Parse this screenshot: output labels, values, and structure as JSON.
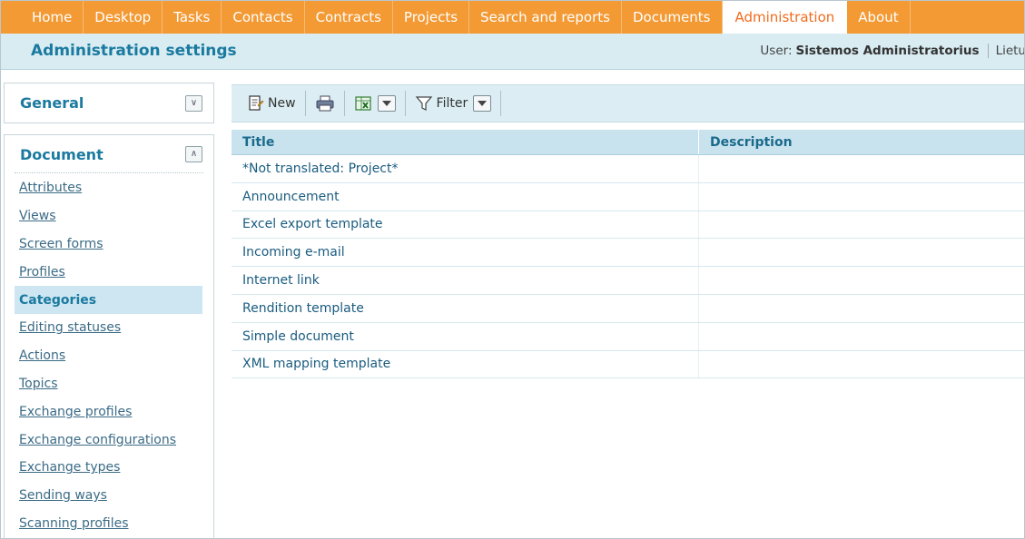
{
  "nav": {
    "tabs": [
      {
        "label": "Home"
      },
      {
        "label": "Desktop"
      },
      {
        "label": "Tasks"
      },
      {
        "label": "Contacts"
      },
      {
        "label": "Contracts"
      },
      {
        "label": "Projects"
      },
      {
        "label": "Search and reports"
      },
      {
        "label": "Documents"
      },
      {
        "label": "Administration",
        "active": true
      },
      {
        "label": "About"
      }
    ]
  },
  "header": {
    "title": "Administration settings",
    "user_prefix": "User:",
    "user_name": "Sistemos Administratorius",
    "language": "Lietu"
  },
  "sidebar": {
    "general_label": "General",
    "document_label": "Document",
    "items": [
      {
        "label": "Attributes"
      },
      {
        "label": "Views"
      },
      {
        "label": "Screen forms"
      },
      {
        "label": "Profiles"
      },
      {
        "label": "Categories",
        "selected": true
      },
      {
        "label": "Editing statuses"
      },
      {
        "label": "Actions"
      },
      {
        "label": "Topics"
      },
      {
        "label": "Exchange profiles"
      },
      {
        "label": "Exchange configurations"
      },
      {
        "label": "Exchange types"
      },
      {
        "label": "Sending ways"
      },
      {
        "label": "Scanning profiles"
      }
    ]
  },
  "toolbar": {
    "new_label": "New",
    "filter_label": "Filter"
  },
  "table": {
    "columns": [
      "Title",
      "Description"
    ],
    "rows": [
      {
        "title": "*Not translated: Project*",
        "description": ""
      },
      {
        "title": "Announcement",
        "description": ""
      },
      {
        "title": "Excel export template",
        "description": ""
      },
      {
        "title": "Incoming e-mail",
        "description": ""
      },
      {
        "title": "Internet link",
        "description": ""
      },
      {
        "title": "Rendition template",
        "description": ""
      },
      {
        "title": "Simple document",
        "description": ""
      },
      {
        "title": "XML mapping template",
        "description": ""
      }
    ]
  },
  "colors": {
    "nav_bg": "#f39a34",
    "active_tab_text": "#f26b1d",
    "header_bg": "#d8ecf2",
    "title_blue": "#1b7aa0",
    "selected_bg": "#cde6f1"
  },
  "icons": {
    "new": "new-document-icon",
    "print": "printer-icon",
    "excel": "excel-icon",
    "filter": "filter-funnel-icon",
    "expand": "chevron-double-down-icon",
    "collapse": "chevron-double-up-icon"
  }
}
